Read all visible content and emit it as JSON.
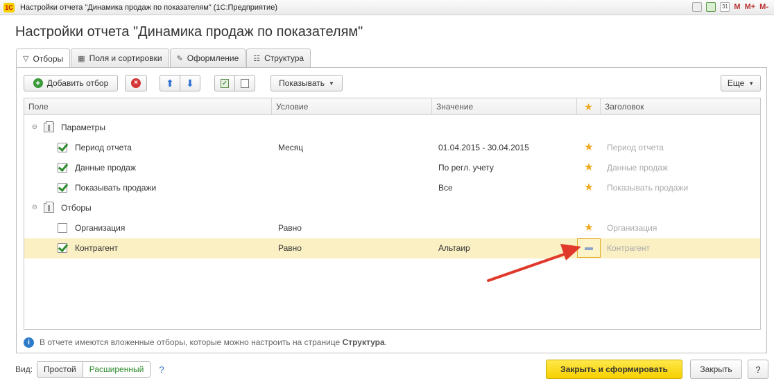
{
  "window": {
    "logo": "1С",
    "title": "Настройки отчета \"Динамика продаж по показателям\"  (1С:Предприятие)",
    "calendar_label": "31",
    "m_label": "M",
    "mplus_label": "M+",
    "mminus_label": "M-"
  },
  "form": {
    "title": "Настройки отчета \"Динамика продаж по показателям\""
  },
  "tabs": [
    {
      "label": "Отборы",
      "icon": "filter-icon"
    },
    {
      "label": "Поля и сортировки",
      "icon": "columns-icon"
    },
    {
      "label": "Оформление",
      "icon": "brush-icon"
    },
    {
      "label": "Структура",
      "icon": "structure-icon"
    }
  ],
  "toolbar": {
    "add_filter": "Добавить отбор",
    "show": "Показывать",
    "more": "Еще"
  },
  "table": {
    "columns": {
      "field": "Поле",
      "condition": "Условие",
      "value": "Значение",
      "star": "★",
      "title": "Заголовок"
    },
    "groups": [
      {
        "label": "Параметры",
        "rows": [
          {
            "field": "Период отчета",
            "checked": true,
            "condition": "Месяц",
            "value": "01.04.2015 - 30.04.2015",
            "title": "Период отчета"
          },
          {
            "field": "Данные продаж",
            "checked": true,
            "condition": "",
            "value": "По регл. учету",
            "title": "Данные продаж"
          },
          {
            "field": "Показывать продажи",
            "checked": true,
            "condition": "",
            "value": "Все",
            "title": "Показывать продажи"
          }
        ]
      },
      {
        "label": "Отборы",
        "rows": [
          {
            "field": "Организация",
            "checked": false,
            "condition": "Равно",
            "value": "",
            "title": "Организация"
          },
          {
            "field": "Контрагент",
            "checked": true,
            "condition": "Равно",
            "value": "Альтаир",
            "title": "Контрагент"
          }
        ]
      }
    ]
  },
  "info": {
    "text": "В отчете имеются вложенные отборы, которые можно настроить на странице",
    "link": "Структура",
    "end": "."
  },
  "bottom": {
    "view_label": "Вид:",
    "simple": "Простой",
    "extended": "Расширенный",
    "help": "?",
    "close_and_build": "Закрыть и сформировать",
    "close": "Закрыть",
    "help_button": "?"
  },
  "colors": {
    "accent_yellow": "#f6d000",
    "star": "#f0a81c",
    "selected_row": "#fbf0c4",
    "annotation_arrow": "#e0392b"
  }
}
